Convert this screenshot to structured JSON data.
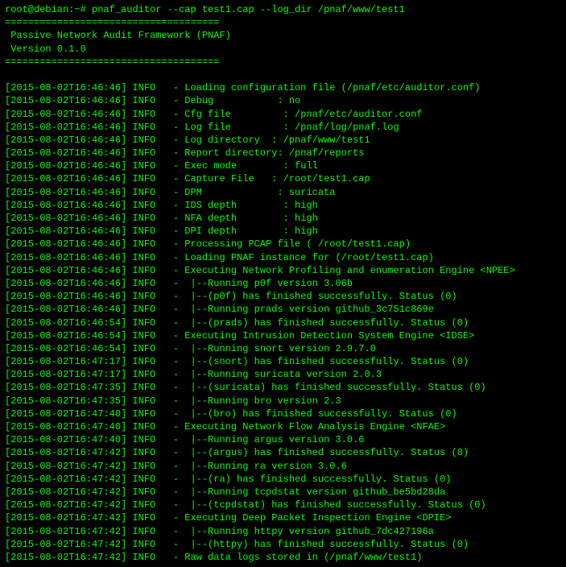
{
  "terminal": {
    "prompt": "root@debian:~# pnaf_auditor --cap test1.cap --log_dir /pnaf/www/test1",
    "separator1": "=====================================",
    "app_name": " Passive Network Audit Framework (PNAF)",
    "version": " Version 0.1.0",
    "separator2": "=====================================",
    "blank1": "",
    "lines": [
      "[2015-08-02T16:46:46] INFO   - Loading configuration file (/pnaf/etc/auditor.conf)",
      "[2015-08-02T16:46:46] INFO   - Debug           : no",
      "[2015-08-02T16:46:46] INFO   - Cfg file         : /pnaf/etc/auditor.conf",
      "[2015-08-02T16:46:46] INFO   - Log file         : /pnaf/log/pnaf.log",
      "[2015-08-02T16:46:46] INFO   - Log directory  : /pnaf/www/test1",
      "[2015-08-02T16:46:46] INFO   - Report directory: /pnaf/reports",
      "[2015-08-02T16:46:46] INFO   - Exec mode        : full",
      "[2015-08-02T16:46:46] INFO   - Capture File   : /root/test1.cap",
      "[2015-08-02T16:46:46] INFO   - DPM             : suricata",
      "[2015-08-02T16:46:46] INFO   - IDS depth        : high",
      "[2015-08-02T16:46:46] INFO   - NFA depth        : high",
      "[2015-08-02T16:46:46] INFO   - DPI depth        : high",
      "[2015-08-02T16:46:46] INFO   - Processing PCAP file ( /root/test1.cap)",
      "[2015-08-02T16:46:46] INFO   - Loading PNAF instance for (/root/test1.cap)",
      "[2015-08-02T16:46:46] INFO   - Executing Network Profiling and enumeration Engine <NPEE>",
      "[2015-08-02T16:46:46] INFO   -  |--Running p0f version 3.06b",
      "[2015-08-02T16:46:46] INFO   -  |--(p0f) has finished successfully. Status (0)",
      "[2015-08-02T16:46:46] INFO   -  |--Running prads version github_3c751c869e",
      "[2015-08-02T16:46:54] INFO   -  |--(prads) has finished successfully. Status (0)",
      "[2015-08-02T16:46:54] INFO   - Executing Intrusion Detection System Engine <IDSE>",
      "[2015-08-02T16:46:54] INFO   -  |--Running snort version 2.9.7.0",
      "[2015-08-02T16:47:17] INFO   -  |--(snort) has finished successfully. Status (0)",
      "[2015-08-02T16:47:17] INFO   -  |--Running suricata version 2.0.3",
      "[2015-08-02T16:47:35] INFO   -  |--(suricata) has finished successfully. Status (0)",
      "[2015-08-02T16:47:35] INFO   -  |--Running bro version 2.3",
      "[2015-08-02T16:47:40] INFO   -  |--(bro) has finished successfully. Status (0)",
      "[2015-08-02T16:47:40] INFO   - Executing Network Flow Analysis Engine <NFAE>",
      "[2015-08-02T16:47:40] INFO   -  |--Running argus version 3.0.6",
      "[2015-08-02T16:47:42] INFO   -  |--(argus) has finished successfully. Status (0)",
      "[2015-08-02T16:47:42] INFO   -  |--Running ra version 3.0.6",
      "[2015-08-02T16:47:42] INFO   -  |--(ra) has finished successfully. Status (0)",
      "[2015-08-02T16:47:42] INFO   -  |--Running tcpdstat version github_be5bd28da",
      "[2015-08-02T16:47:42] INFO   -  |--(tcpdstat) has finished successfully. Status (0)",
      "[2015-08-02T16:47:42] INFO   - Executing Deep Packet Inspection Engine <DPIE>",
      "[2015-08-02T16:47:42] INFO   -  |--Running httpy version github_7dc427196a",
      "[2015-08-02T16:47:42] INFO   -  |--(httpy) has finished successfully. Status (0)",
      "[2015-08-02T16:47:42] INFO   - Raw data logs stored in (/pnaf/www/test1)"
    ]
  }
}
